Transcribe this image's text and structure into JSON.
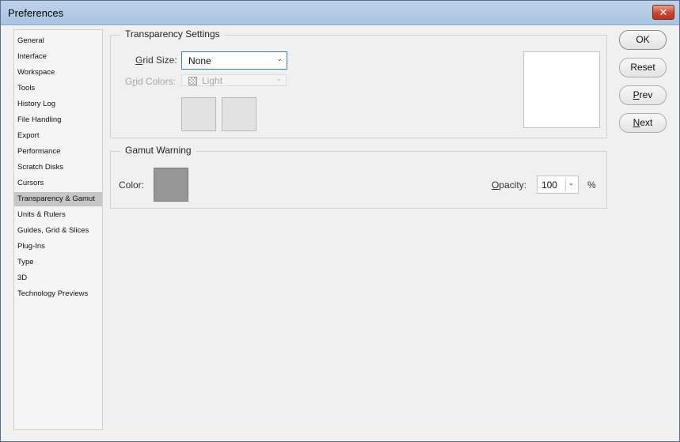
{
  "window": {
    "title": "Preferences",
    "close_symbol": "✕"
  },
  "sidebar": {
    "selected_index": 10,
    "items": [
      {
        "label": "General"
      },
      {
        "label": "Interface"
      },
      {
        "label": "Workspace"
      },
      {
        "label": "Tools"
      },
      {
        "label": "History Log"
      },
      {
        "label": "File Handling"
      },
      {
        "label": "Export"
      },
      {
        "label": "Performance"
      },
      {
        "label": "Scratch Disks"
      },
      {
        "label": "Cursors"
      },
      {
        "label": "Transparency & Gamut"
      },
      {
        "label": "Units & Rulers"
      },
      {
        "label": "Guides, Grid & Slices"
      },
      {
        "label": "Plug-Ins"
      },
      {
        "label": "Type"
      },
      {
        "label": "3D"
      },
      {
        "label": "Technology Previews"
      }
    ]
  },
  "transparency": {
    "legend": "Transparency Settings",
    "grid_size_label_key": "G",
    "grid_size_label_rest": "rid Size:",
    "grid_size_value": "None",
    "grid_colors_label_key": "r",
    "grid_colors_label_pre": "G",
    "grid_colors_label_rest": "id Colors:",
    "grid_colors_value": "Light"
  },
  "gamut": {
    "legend": "Gamut Warning",
    "color_label": "Color:",
    "swatch_color": "#969696",
    "opacity_label_key": "O",
    "opacity_label_rest": "pacity:",
    "opacity_value": "100",
    "opacity_unit": "%"
  },
  "buttons": {
    "ok": "OK",
    "reset": "Reset",
    "prev_key": "P",
    "prev_rest": "rev",
    "next_key": "N",
    "next_rest": "ext"
  },
  "icons": {
    "dropdown": "chevron-down-icon",
    "checker": "checker-icon",
    "close": "close-icon"
  }
}
